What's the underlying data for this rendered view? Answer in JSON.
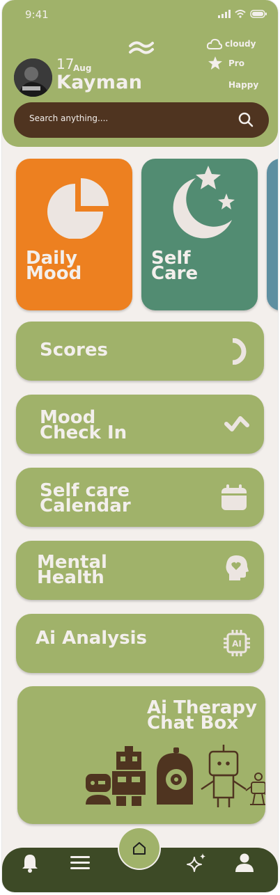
{
  "status": {
    "time": "9:41"
  },
  "profile": {
    "day": "17",
    "month": "Aug",
    "name": "Kayman"
  },
  "info": {
    "weather": "cloudy",
    "plan": "Pro",
    "mood": "Happy"
  },
  "search": {
    "placeholder": "Search anything...."
  },
  "cards": [
    {
      "line1": "Daily",
      "line2": "Mood",
      "color": "#ed8020"
    },
    {
      "line1": "Self",
      "line2": "Care",
      "color": "#528c72"
    }
  ],
  "menu": {
    "scores": "Scores",
    "mood_check_1": "Mood",
    "mood_check_2": "Check In",
    "calendar_1": "Self care",
    "calendar_2": "Calendar",
    "mental_1": "Mental",
    "mental_2": "Health",
    "ai_analysis": "Ai Analysis",
    "therapy_1": "Ai Therapy",
    "therapy_2": "Chat Box"
  },
  "colors": {
    "header": "#a0b26a",
    "dark_brown": "#4f3420",
    "cream": "#f3efec",
    "nav": "#3d4a26",
    "orange": "#ed8020",
    "teal": "#528c72",
    "blue": "#5e8fa1"
  },
  "icons": [
    "bell-icon",
    "menu-icon",
    "home-icon",
    "sparkle-icon",
    "user-icon"
  ]
}
